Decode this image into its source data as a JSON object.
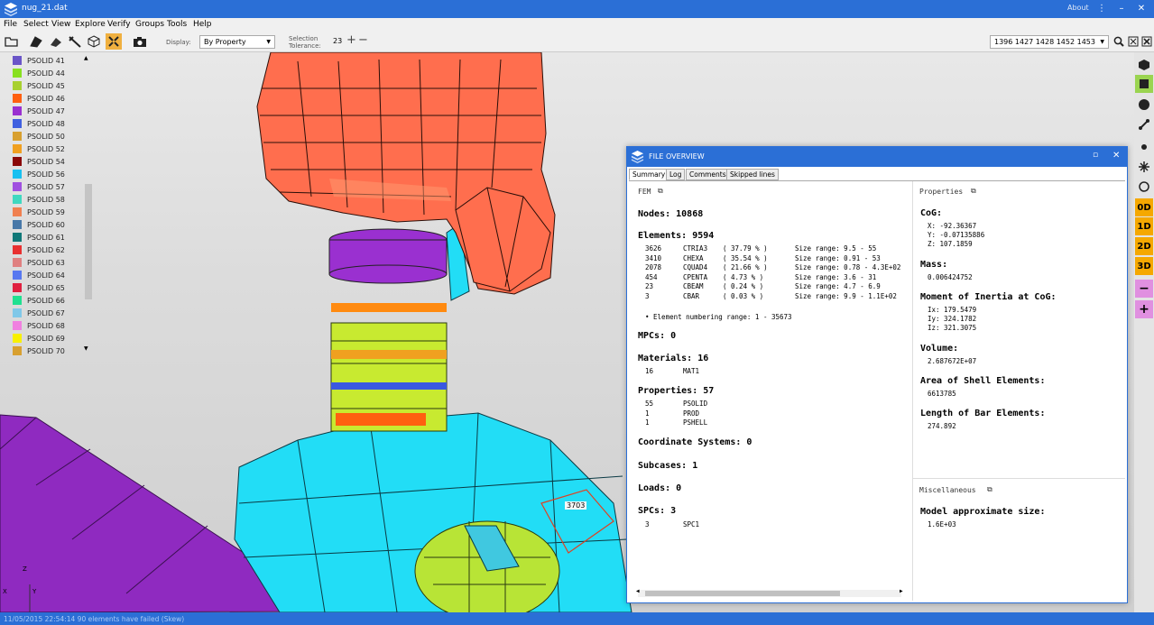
{
  "window": {
    "title": "nug_21.dat",
    "about": "About"
  },
  "menu": [
    "File",
    "Select",
    "View",
    "Explore",
    "Verify",
    "Groups",
    "Tools",
    "Help"
  ],
  "toolbar": {
    "display_label": "Display:",
    "display_value": "By Property",
    "tol_label_1": "Selection",
    "tol_label_2": "Tolerance:",
    "tol_value": "23",
    "selection_ids": "1396 1427 1428 1452 1453"
  },
  "properties_list": [
    {
      "label": "PSOLID 41",
      "color": "#6a55c8"
    },
    {
      "label": "PSOLID 44",
      "color": "#88e020"
    },
    {
      "label": "PSOLID 45",
      "color": "#a8d030"
    },
    {
      "label": "PSOLID 46",
      "color": "#ff6010"
    },
    {
      "label": "PSOLID 47",
      "color": "#9a30d0"
    },
    {
      "label": "PSOLID 48",
      "color": "#4060e0"
    },
    {
      "label": "PSOLID 50",
      "color": "#d8a030"
    },
    {
      "label": "PSOLID 52",
      "color": "#f0a020"
    },
    {
      "label": "PSOLID 54",
      "color": "#8a0808"
    },
    {
      "label": "PSOLID 56",
      "color": "#18c0f0"
    },
    {
      "label": "PSOLID 57",
      "color": "#a050e0"
    },
    {
      "label": "PSOLID 58",
      "color": "#40d8c0"
    },
    {
      "label": "PSOLID 59",
      "color": "#f08050"
    },
    {
      "label": "PSOLID 60",
      "color": "#4878a8"
    },
    {
      "label": "PSOLID 61",
      "color": "#107878"
    },
    {
      "label": "PSOLID 62",
      "color": "#e83030"
    },
    {
      "label": "PSOLID 63",
      "color": "#e08080"
    },
    {
      "label": "PSOLID 64",
      "color": "#5878f0"
    },
    {
      "label": "PSOLID 65",
      "color": "#e02040"
    },
    {
      "label": "PSOLID 66",
      "color": "#20e090"
    },
    {
      "label": "PSOLID 67",
      "color": "#80c8e8"
    },
    {
      "label": "PSOLID 68",
      "color": "#f080e0"
    },
    {
      "label": "PSOLID 69",
      "color": "#f8f000"
    },
    {
      "label": "PSOLID 70",
      "color": "#d8a030"
    }
  ],
  "viewport": {
    "node_label": "3703"
  },
  "right_tools": {
    "t0d": "0D",
    "t1d": "1D",
    "t2d": "2D",
    "t3d": "3D",
    "minus": "−",
    "plus": "+"
  },
  "status": "11/05/2015 22:54:14 90 elements have failed (Skew)",
  "axes": {
    "x": "X",
    "y": "Y",
    "z": "Z"
  },
  "dialog": {
    "title": "FILE OVERVIEW",
    "tabs": [
      "Summary",
      "Log",
      "Comments",
      "Skipped lines"
    ],
    "fem_header": "FEM",
    "nodes": "Nodes: 10868",
    "elements": "Elements: 9594",
    "element_rows": [
      {
        "n": "3626",
        "t": "CTRIA3",
        "p": "( 37.79 % )",
        "s": "Size range: 9.5 - 55"
      },
      {
        "n": "3410",
        "t": "CHEXA",
        "p": "( 35.54 % )",
        "s": "Size range: 0.91 - 53"
      },
      {
        "n": "2078",
        "t": "CQUAD4",
        "p": "( 21.66 % )",
        "s": "Size range: 0.78 - 4.3E+02"
      },
      {
        "n": "454",
        "t": "CPENTA",
        "p": "( 4.73 % )",
        "s": "Size range: 3.6 - 31"
      },
      {
        "n": "23",
        "t": "CBEAM",
        "p": "( 0.24 % )",
        "s": "Size range: 4.7 - 6.9"
      },
      {
        "n": "3",
        "t": "CBAR",
        "p": "( 0.03 % )",
        "s": "Size range: 9.9 - 1.1E+02"
      }
    ],
    "numbering": "• Element numbering range: 1 - 35673",
    "mpcs": "MPCs: 0",
    "materials": "Materials: 16",
    "materials_rows": [
      {
        "n": "16",
        "t": "MAT1"
      }
    ],
    "properties": "Properties: 57",
    "properties_rows": [
      {
        "n": "55",
        "t": "PSOLID"
      },
      {
        "n": "1",
        "t": "PROD"
      },
      {
        "n": "1",
        "t": "PSHELL"
      }
    ],
    "coord": "Coordinate Systems: 0",
    "subcases": "Subcases: 1",
    "loads": "Loads: 0",
    "spcs": "SPCs: 3",
    "spcs_rows": [
      {
        "n": "3",
        "t": "SPC1"
      }
    ],
    "right_header": "Properties",
    "cog": "CoG:",
    "cog_x": "X: -92.36367",
    "cog_y": "Y: -0.07135886",
    "cog_z": "Z: 107.1859",
    "mass": "Mass:",
    "mass_v": "0.006424752",
    "moi": "Moment of Inertia at CoG:",
    "ix": "Ix: 179.5479",
    "iy": "Iy: 324.1782",
    "iz": "Iz: 321.3075",
    "volume": "Volume:",
    "volume_v": "2.687672E+07",
    "area": "Area of Shell Elements:",
    "area_v": "6613785",
    "length": "Length of Bar Elements:",
    "length_v": "274.892",
    "misc_header": "Miscellaneous",
    "approx": "Model approximate size:",
    "approx_v": "1.6E+03"
  }
}
